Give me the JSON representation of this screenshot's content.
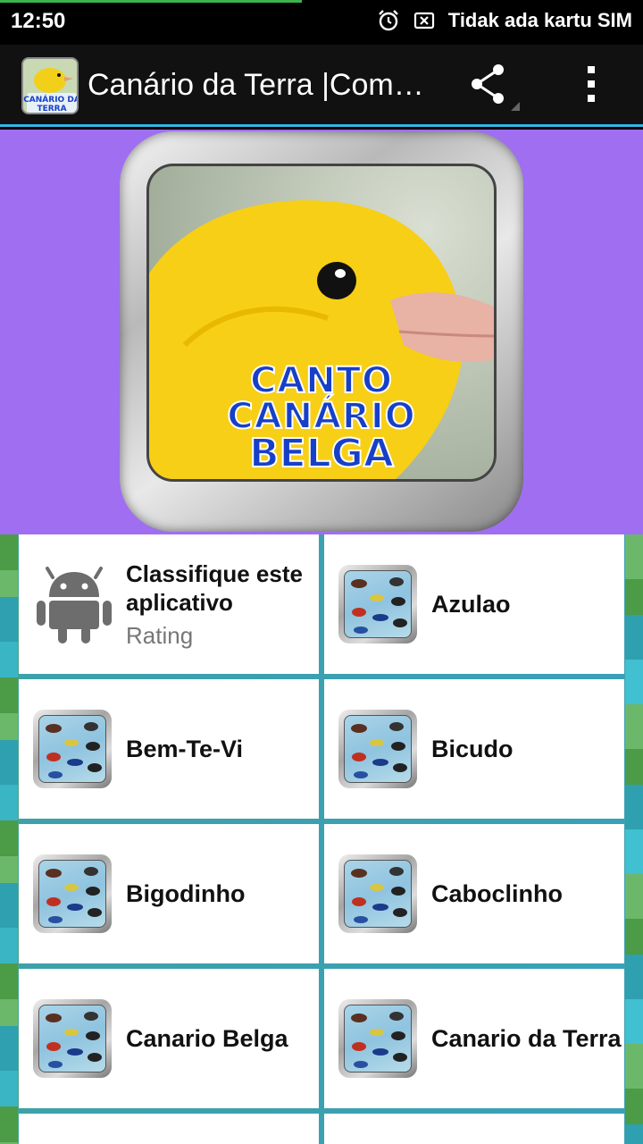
{
  "status_bar": {
    "time": "12:50",
    "carrier": "Tidak ada kartu SIM",
    "icons": [
      "alarm-icon",
      "no-sim-icon"
    ],
    "progress": 0.47
  },
  "action_bar": {
    "title": "Canário da Terra |Com…",
    "app_icon_text": [
      "CANÁRIO DA",
      "TERRA"
    ],
    "actions": [
      "share-icon",
      "overflow-menu-icon"
    ]
  },
  "banner": {
    "line1": "CANTO CANÁRIO",
    "line2": "BELGA",
    "background": "#a06ef0"
  },
  "rating": {
    "title": "Classifique este aplicativo",
    "subtitle": "Rating",
    "icon": "android-icon"
  },
  "items": [
    {
      "label": "Azulao"
    },
    {
      "label": "Bem-Te-Vi"
    },
    {
      "label": "Bicudo"
    },
    {
      "label": "Bigodinho"
    },
    {
      "label": "Caboclinho"
    },
    {
      "label": "Canario Belga"
    },
    {
      "label": "Canario da Terra"
    }
  ],
  "colors": {
    "accent": "#33b5e5",
    "action_bar": "#111111",
    "status_progress": "#3bb54a"
  }
}
